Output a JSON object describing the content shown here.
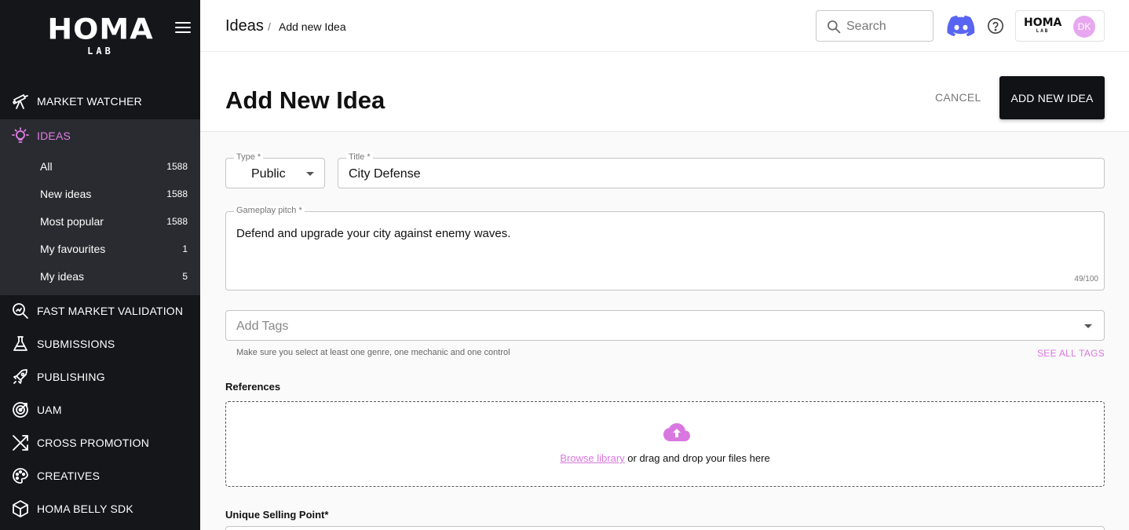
{
  "sidebar": {
    "logo_main": "HOMA",
    "logo_sub": "LAB",
    "nav": [
      {
        "label": "MARKET WATCHER",
        "icon": "telescope-icon"
      },
      {
        "label": "IDEAS",
        "icon": "lightbulb-icon"
      },
      {
        "label": "FAST MARKET VALIDATION",
        "icon": "magnifier-chart-icon"
      },
      {
        "label": "SUBMISSIONS",
        "icon": "flask-icon"
      },
      {
        "label": "PUBLISHING",
        "icon": "rocket-icon"
      },
      {
        "label": "UAM",
        "icon": "target-icon"
      },
      {
        "label": "CROSS PROMOTION",
        "icon": "shuffle-icon"
      },
      {
        "label": "CREATIVES",
        "icon": "palette-icon"
      },
      {
        "label": "HOMA BELLY SDK",
        "icon": "cube-icon"
      }
    ],
    "ideas_sub": [
      {
        "label": "All",
        "count": "1588"
      },
      {
        "label": "New ideas",
        "count": "1588"
      },
      {
        "label": "Most popular",
        "count": "1588"
      },
      {
        "label": "My favourites",
        "count": "1"
      },
      {
        "label": "My ideas",
        "count": "5"
      }
    ],
    "active_color": "#e07fe8"
  },
  "header": {
    "breadcrumb_root": "Ideas",
    "breadcrumb_sep": "/",
    "breadcrumb_current": "Add new Idea",
    "search_placeholder": "Search",
    "account_logo_main": "HOMA",
    "account_logo_sub": "LAB",
    "avatar_initials": "DK"
  },
  "page": {
    "title": "Add New Idea",
    "cancel_label": "CANCEL",
    "add_label": "ADD NEW IDEA"
  },
  "form": {
    "type_label": "Type *",
    "type_value": "Public",
    "title_label": "Title *",
    "title_value": "City Defense",
    "pitch_label": "Gameplay pitch *",
    "pitch_value": "Defend and upgrade your city against enemy waves.",
    "pitch_counter": "49/100",
    "tags_placeholder": "Add Tags",
    "tags_helper": "Make sure you select at least one genre, one mechanic and one control",
    "see_all_tags": "SEE ALL TAGS",
    "references_label": "References",
    "browse_link": "Browse library",
    "drop_text": " or drag and drop your files here",
    "usp_label": "Unique Selling Point*"
  },
  "colors": {
    "accent": "#d977e0",
    "sidebar_bg": "#15161a",
    "primary_button": "#111216"
  }
}
